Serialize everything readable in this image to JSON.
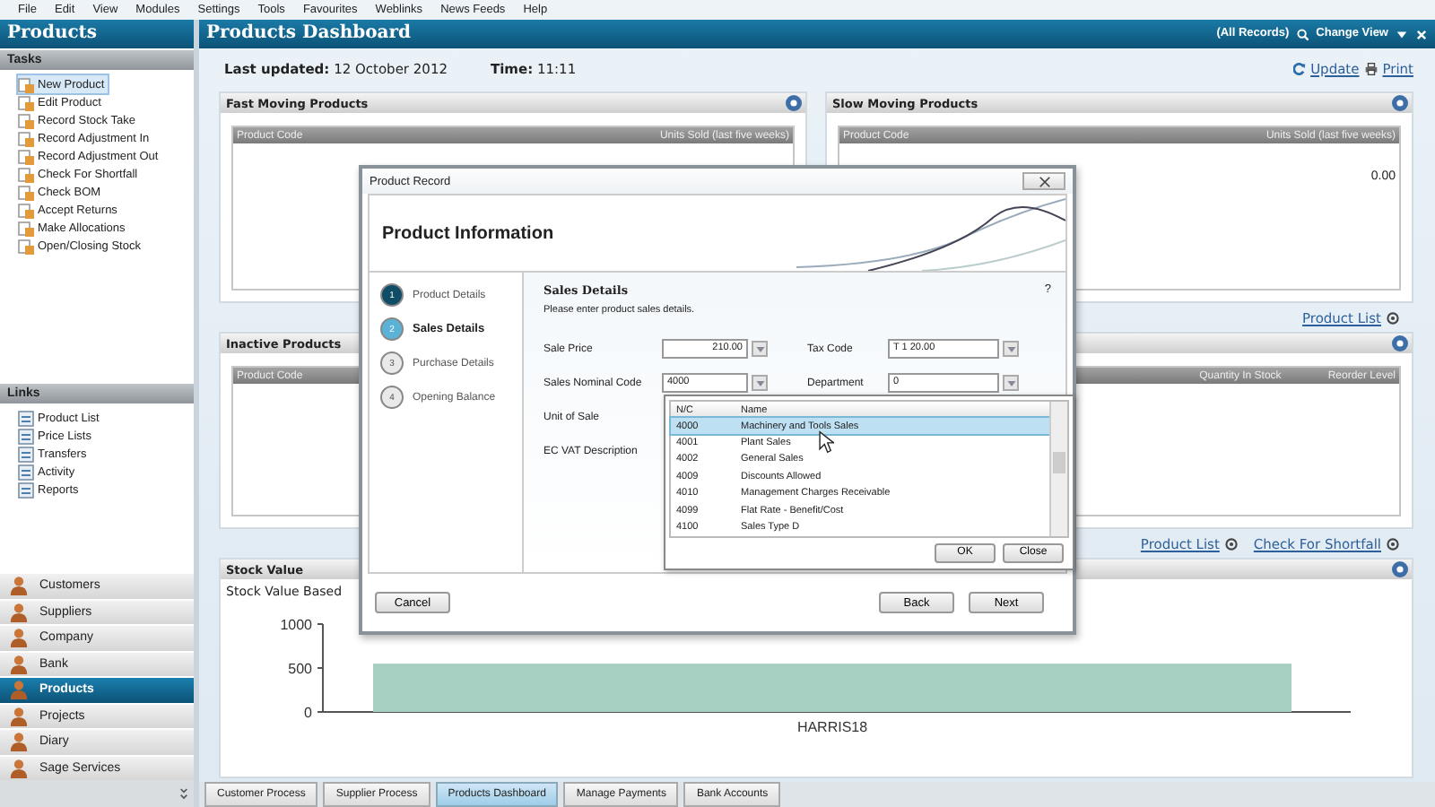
{
  "menu": [
    "File",
    "Edit",
    "View",
    "Modules",
    "Settings",
    "Tools",
    "Favourites",
    "Weblinks",
    "News Feeds",
    "Help"
  ],
  "sidebar": {
    "title": "Products",
    "tasks_header": "Tasks",
    "tasks": [
      {
        "label": "New Product",
        "selected": true
      },
      {
        "label": "Edit Product",
        "selected": false
      },
      {
        "label": "Record Stock Take",
        "selected": false
      },
      {
        "label": "Record Adjustment In",
        "selected": false
      },
      {
        "label": "Record Adjustment Out",
        "selected": false
      },
      {
        "label": "Check For Shortfall",
        "selected": false
      },
      {
        "label": "Check BOM",
        "selected": false
      },
      {
        "label": "Accept Returns",
        "selected": false
      },
      {
        "label": "Make Allocations",
        "selected": false
      },
      {
        "label": "Open/Closing Stock",
        "selected": false
      }
    ],
    "links_header": "Links",
    "links": [
      "Product List",
      "Price Lists",
      "Transfers",
      "Activity",
      "Reports"
    ],
    "nav": [
      {
        "label": "Customers",
        "selected": false
      },
      {
        "label": "Suppliers",
        "selected": false
      },
      {
        "label": "Company",
        "selected": false
      },
      {
        "label": "Bank",
        "selected": false
      },
      {
        "label": "Products",
        "selected": true
      },
      {
        "label": "Projects",
        "selected": false
      },
      {
        "label": "Diary",
        "selected": false
      },
      {
        "label": "Sage Services",
        "selected": false
      }
    ]
  },
  "main": {
    "title": "Products Dashboard",
    "record_filter": "(All Records)",
    "change_view": "Change View",
    "last_updated_label": "Last updated:",
    "last_updated": "12 October 2012",
    "time_label": "Time:",
    "time": "11:11",
    "update": "Update",
    "print": "Print",
    "fast_moving": {
      "title": "Fast Moving Products",
      "columns": [
        "Product Code",
        "Units Sold (last five weeks)"
      ]
    },
    "slow_moving": {
      "title": "Slow Moving Products",
      "columns": [
        "Product Code",
        "Units Sold (last five weeks)"
      ],
      "value": "0.00"
    },
    "slow_link": "Product List",
    "inactive": {
      "title": "Inactive Products",
      "columns": [
        "Product Code",
        "Quantity In Stock",
        "Reorder Level"
      ]
    },
    "inactive_links": [
      "Product List",
      "Check For Shortfall"
    ],
    "stock_value": {
      "title": "Stock Value",
      "subtitle": "Stock Value Based",
      "chart_data": {
        "type": "bar",
        "categories": [
          "HARRIS18"
        ],
        "values": [
          550
        ],
        "ylim": [
          0,
          1000
        ],
        "yticks": [
          0,
          500,
          1000
        ]
      }
    }
  },
  "tabs": [
    {
      "label": "Customer Process",
      "selected": false
    },
    {
      "label": "Supplier Process",
      "selected": false
    },
    {
      "label": "Products Dashboard",
      "selected": true
    },
    {
      "label": "Manage Payments",
      "selected": false
    },
    {
      "label": "Bank Accounts",
      "selected": false
    }
  ],
  "dialog": {
    "title": "Product Record",
    "heading": "Product Information",
    "steps": [
      {
        "number": "1",
        "label": "Product Details",
        "kind": "done"
      },
      {
        "number": "2",
        "label": "Sales Details",
        "kind": "current"
      },
      {
        "number": "3",
        "label": "Purchase Details",
        "kind": "pending"
      },
      {
        "number": "4",
        "label": "Opening Balance",
        "kind": "pending"
      }
    ],
    "section_title": "Sales Details",
    "instruction": "Please enter product sales details.",
    "help": "?",
    "rows": [
      [
        {
          "label": "Sale Price",
          "value": "210.00",
          "kind": "spin"
        },
        {
          "label": "Tax Code",
          "value": "T 1 20.00",
          "kind": "combo"
        }
      ],
      [
        {
          "label": "Sales Nominal Code",
          "value": "4000",
          "kind": "combo"
        },
        {
          "label": "Department",
          "value": "0",
          "kind": "combo"
        }
      ],
      [
        {
          "label": "Unit of Sale",
          "kind": "label"
        }
      ],
      [
        {
          "label": "EC VAT Description",
          "kind": "label"
        }
      ]
    ],
    "popup": {
      "columns": [
        "N/C",
        "Name"
      ],
      "rows": [
        {
          "code": "4000",
          "name": "Machinery and Tools Sales",
          "selected": true
        },
        {
          "code": "4001",
          "name": "Plant Sales",
          "selected": false
        },
        {
          "code": "4002",
          "name": "General Sales",
          "selected": false
        },
        {
          "code": "4009",
          "name": "Discounts Allowed",
          "selected": false
        },
        {
          "code": "4010",
          "name": "Management Charges Receivable",
          "selected": false
        },
        {
          "code": "4099",
          "name": "Flat Rate - Benefit/Cost",
          "selected": false
        },
        {
          "code": "4100",
          "name": "Sales Type D",
          "selected": false
        }
      ],
      "buttons": [
        "OK",
        "Close"
      ]
    },
    "buttons_left": [
      "Cancel"
    ],
    "buttons_right": [
      "Back",
      "Next"
    ]
  }
}
